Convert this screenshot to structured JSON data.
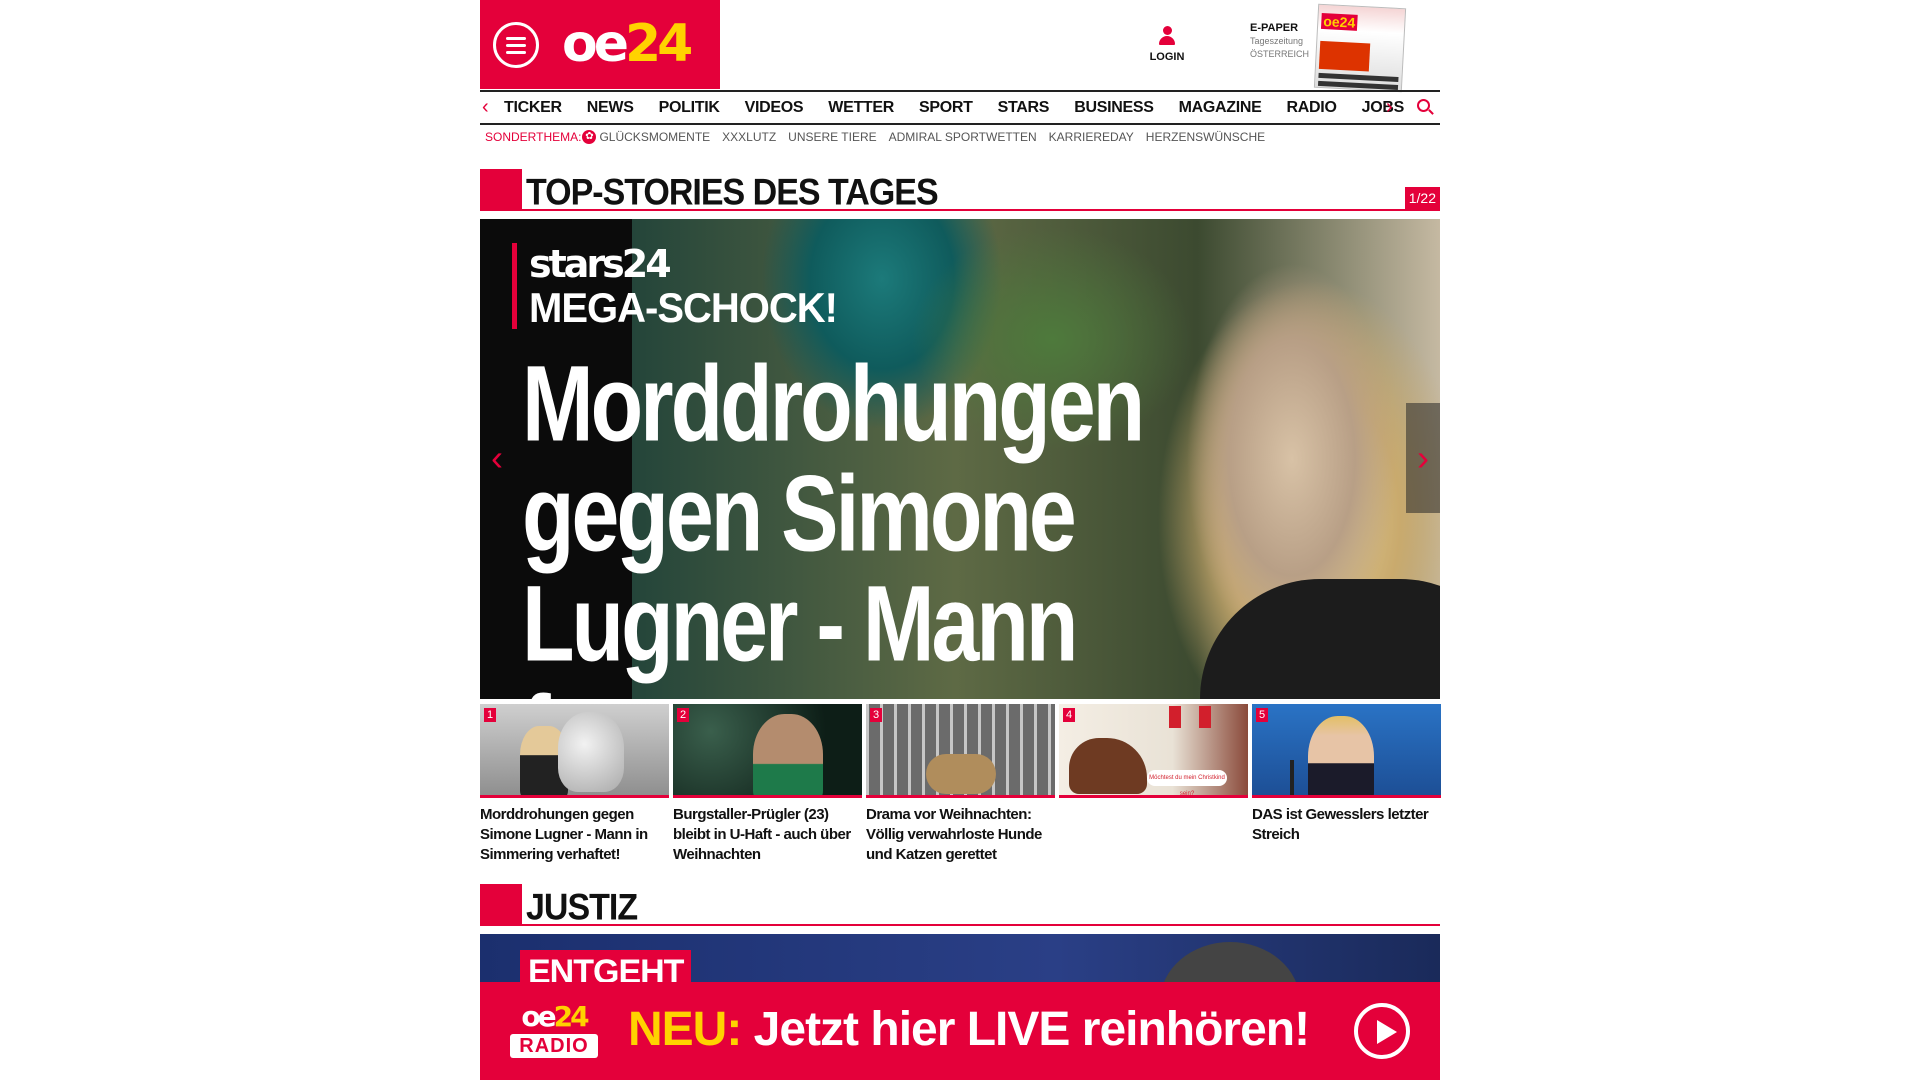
{
  "header": {
    "logo": {
      "oe": "oe",
      "num": "24"
    },
    "login_label": "LOGIN",
    "epaper": {
      "title": "E-PAPER",
      "line1": "Tageszeitung",
      "line2": "ÖSTERREICH",
      "cover_logo": "oe24"
    },
    "icons": {
      "menu": "hamburger-icon",
      "login": "user-icon",
      "search": "search-icon"
    }
  },
  "nav": {
    "items": [
      "TICKER",
      "NEWS",
      "POLITIK",
      "VIDEOS",
      "WETTER",
      "SPORT",
      "STARS",
      "BUSINESS",
      "MAGAZINE",
      "RADIO",
      "JOBS"
    ],
    "prev": "‹",
    "next": "›"
  },
  "subnav": {
    "label": "SONDERTHEMA:",
    "items": [
      "GLÜCKSMOMENTE",
      "XXXLUTZ",
      "UNSERE TIERE",
      "ADMIRAL SPORTWETTEN",
      "KARRIEREDAY",
      "HERZENSWÜNSCHE"
    ]
  },
  "topstories": {
    "title": "TOP-STORIES DES TAGES",
    "counter": "1/22",
    "hero": {
      "brand": "stars24",
      "kicker": "MEGA-SCHOCK!",
      "headline": "Morddrohungen gegen Simone Lugner - Mann festgenommen",
      "prev": "‹",
      "next": "›"
    },
    "items": [
      {
        "num": "1",
        "caption": "Morddrohungen gegen Simone Lugner - Mann in Simmering verhaftet!"
      },
      {
        "num": "2",
        "caption": "Burgstaller-Prügler (23) bleibt in U-Haft - auch über Weihnachten"
      },
      {
        "num": "3",
        "caption": "Drama vor Weihnachten: Völlig verwahrloste Hunde und Katzen gerettet"
      },
      {
        "num": "4",
        "caption": "",
        "bubble": "Möchtest du mein Christkind sein?"
      },
      {
        "num": "5",
        "caption": "DAS ist Gewesslers letzter Streich"
      }
    ]
  },
  "justiz": {
    "title": "JUSTIZ",
    "preview_tag": "ENTGEHT"
  },
  "radio_banner": {
    "logo_top_a": "oe",
    "logo_top_b": "24",
    "logo_bottom": "RADIO",
    "neu": "NEU:",
    "text": "Jetzt hier LIVE reinhören!"
  },
  "colors": {
    "brand_red": "#e4003a",
    "brand_yellow": "#ffd200"
  }
}
